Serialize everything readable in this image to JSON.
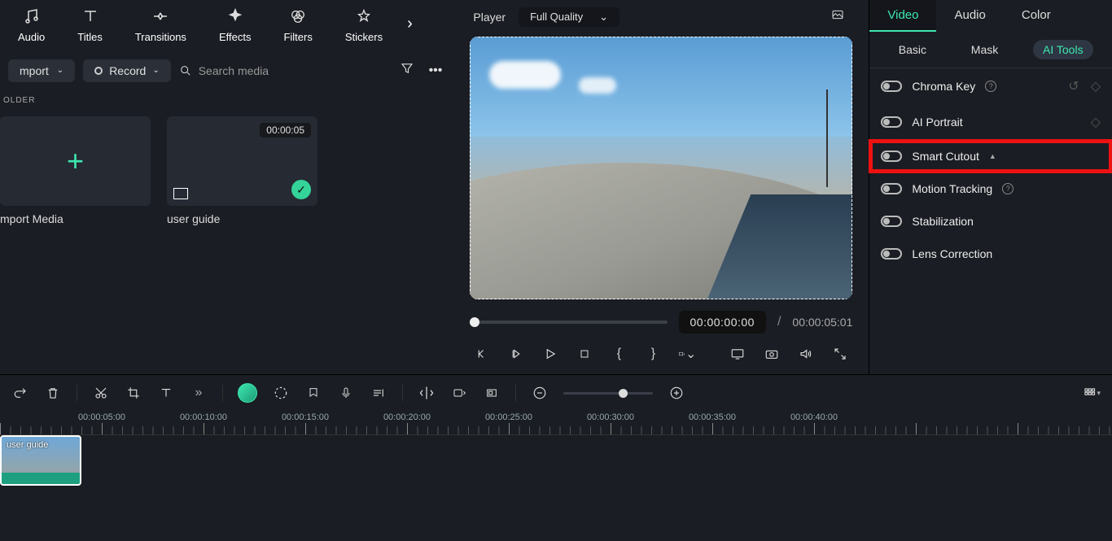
{
  "toolbar": {
    "items": [
      {
        "label": "Audio",
        "icon": "music-icon"
      },
      {
        "label": "Titles",
        "icon": "text-icon"
      },
      {
        "label": "Transitions",
        "icon": "transition-icon"
      },
      {
        "label": "Effects",
        "icon": "sparkle-icon"
      },
      {
        "label": "Filters",
        "icon": "filter-circles-icon"
      },
      {
        "label": "Stickers",
        "icon": "sticker-icon"
      }
    ]
  },
  "media": {
    "import_dropdown": "mport",
    "record_label": "Record",
    "search_placeholder": "Search media",
    "folder_label": "OLDER",
    "import_card_label": "mport Media",
    "clips": [
      {
        "name": "user guide",
        "duration": "00:00:05"
      }
    ]
  },
  "player": {
    "title": "Player",
    "quality": "Full Quality",
    "current_time": "00:00:00:00",
    "total_time": "00:00:05:01"
  },
  "right_panel": {
    "tabs": [
      "Video",
      "Audio",
      "Color"
    ],
    "active_tab": "Video",
    "subtabs": [
      "Basic",
      "Mask",
      "AI Tools"
    ],
    "active_subtab": "AI Tools",
    "items": [
      {
        "label": "Chroma Key",
        "info": true,
        "reset": true,
        "keyframe": true
      },
      {
        "label": "AI Portrait",
        "keyframe": true
      },
      {
        "label": "Smart Cutout",
        "caret": true,
        "highlight": true
      },
      {
        "label": "Motion Tracking",
        "info": true
      },
      {
        "label": "Stabilization"
      },
      {
        "label": "Lens Correction"
      }
    ]
  },
  "timeline": {
    "ruler_marks": [
      "",
      "00:00:05:00",
      "00:00:10:00",
      "00:00:15:00",
      "00:00:20:00",
      "00:00:25:00",
      "00:00:30:00",
      "00:00:35:00",
      "00:00:40:00"
    ],
    "clip_label": "user guide"
  }
}
